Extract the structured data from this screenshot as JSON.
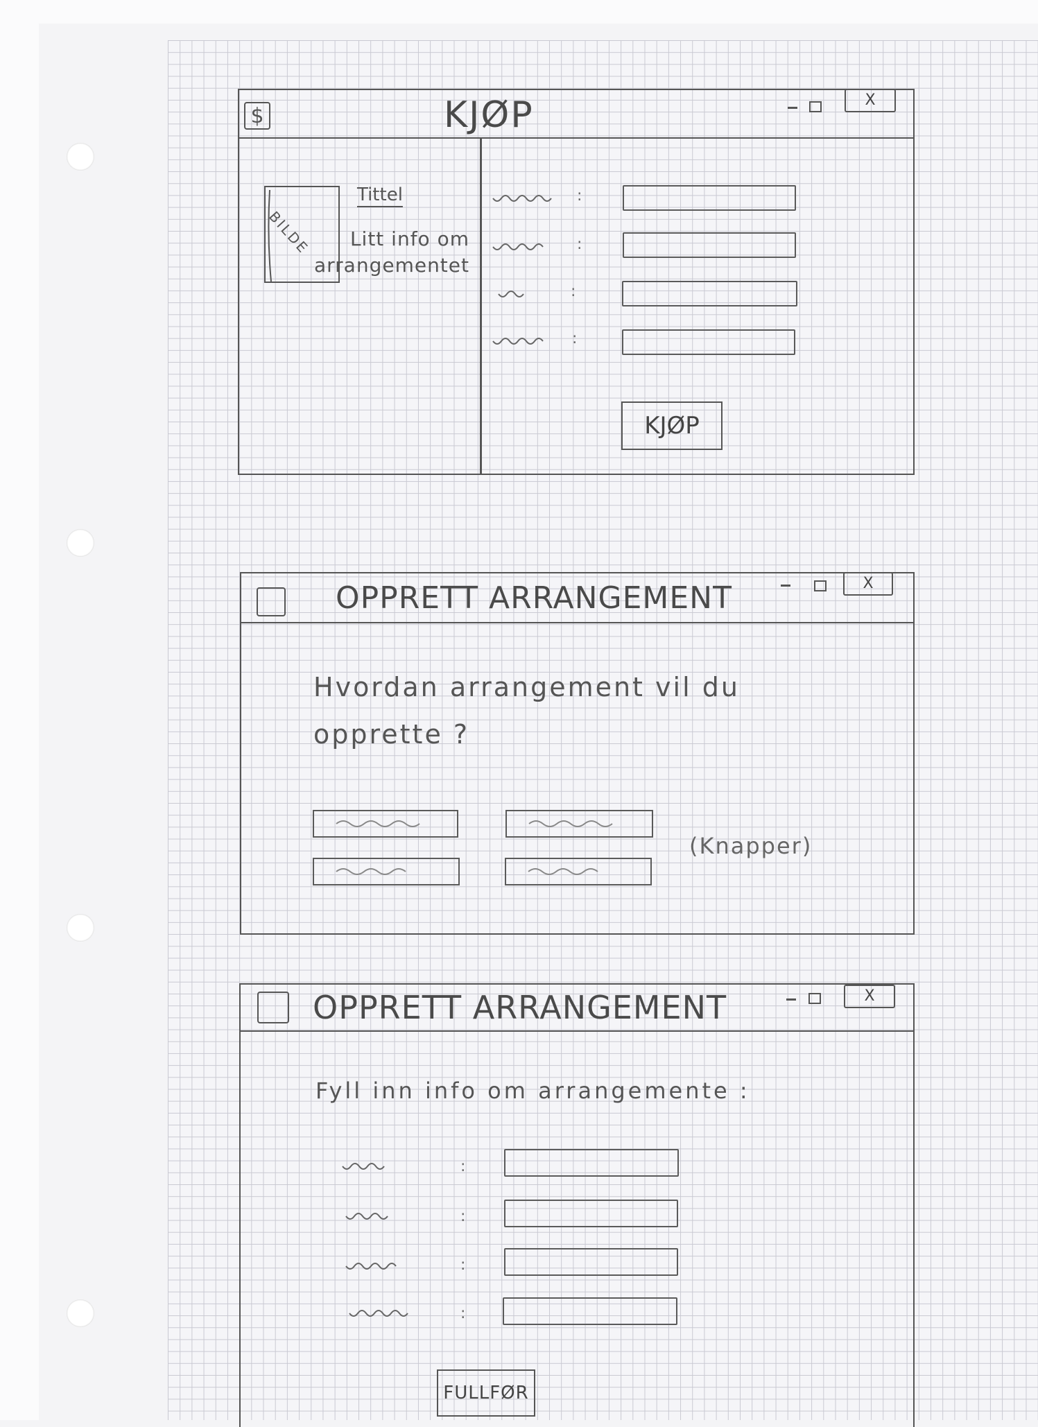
{
  "win1": {
    "icon": "dollar-icon",
    "title": "KJØP",
    "image_label": "BILDE",
    "event_title": "Tittel",
    "event_info": "Litt info om arrangementet",
    "colon": ":",
    "buy_button": "KJØP"
  },
  "win2": {
    "icon": "folder-icon",
    "title": "OPPRETT ARRANGEMENT",
    "question": "Hvordan arrangement vil du opprette ?",
    "buttons_note": "(Knapper)"
  },
  "win3": {
    "icon": "folder-icon",
    "title": "OPPRETT ARRANGEMENT",
    "prompt": "Fyll inn info om arrangemente :",
    "colon": ":",
    "finish_button": "FULLFØR"
  },
  "window_controls": {
    "minimize_icon": "minimize-icon",
    "maximize_icon": "maximize-icon",
    "close_label": "X"
  },
  "colors": {
    "pencil": "#555555",
    "grid": "#c9c9d2",
    "paper": "#f5f5f8"
  }
}
